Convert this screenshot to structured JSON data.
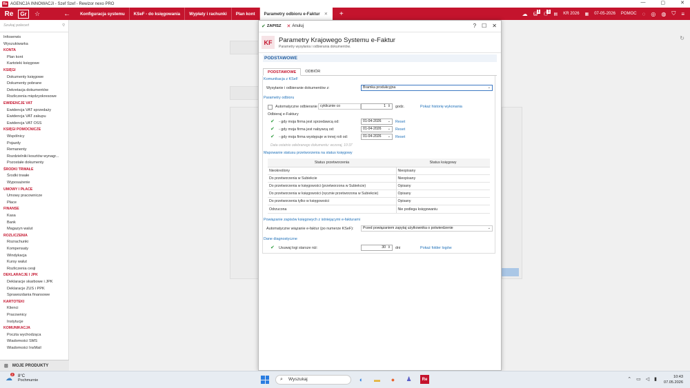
{
  "window": {
    "app_icon": "Re",
    "title": "AGENCJA INNOWACJI - Szef Szef - Rewizor nexo PRO",
    "controls": [
      "—",
      "▢",
      "✕"
    ]
  },
  "toolbar": {
    "logo": "Re",
    "logo2": "Gr",
    "tabs": [
      "Konfiguracja systemu",
      "KSeF - do księgowania",
      "Wypłaty i rachunki",
      "Plan kont",
      "Parametry odbioru e-Faktur"
    ],
    "active_tab_close": "✕",
    "right": {
      "badge1": "1",
      "badge2": "1",
      "year": "KR 2026",
      "date": "07-05-2026",
      "help": "POMOC"
    }
  },
  "sidebar": {
    "search_placeholder": "Szukaj poleceń",
    "items": [
      {
        "t": "Infoserwis",
        "k": "top"
      },
      {
        "t": "Wyszukiwarka",
        "k": "top"
      },
      {
        "t": "KONTA",
        "k": "sec"
      },
      {
        "t": "Plan kont",
        "k": "it"
      },
      {
        "t": "Kartoteki księgowe",
        "k": "it"
      },
      {
        "t": "KSIĘGI",
        "k": "sec"
      },
      {
        "t": "Dokumenty księgowe",
        "k": "it"
      },
      {
        "t": "Dokumenty pobrane",
        "k": "it"
      },
      {
        "t": "Dekretacja dokumentów",
        "k": "it"
      },
      {
        "t": "Rozliczenia międzyokresowe",
        "k": "it"
      },
      {
        "t": "EWIDENCJE VAT",
        "k": "sec"
      },
      {
        "t": "Ewidencja VAT sprzedaży",
        "k": "it"
      },
      {
        "t": "Ewidencja VAT zakupu",
        "k": "it"
      },
      {
        "t": "Ewidencja VAT OSS",
        "k": "it"
      },
      {
        "t": "KSIĘGI POMOCNICZE",
        "k": "sec"
      },
      {
        "t": "Wspólnicy",
        "k": "it"
      },
      {
        "t": "Pojazdy",
        "k": "it"
      },
      {
        "t": "Remanenty",
        "k": "it"
      },
      {
        "t": "Rozdzielniki kosztów wynagr...",
        "k": "it"
      },
      {
        "t": "Pozostałe dokumenty",
        "k": "it"
      },
      {
        "t": "ŚRODKI TRWAŁE",
        "k": "sec"
      },
      {
        "t": "Środki trwałe",
        "k": "it"
      },
      {
        "t": "Wyposażenie",
        "k": "it"
      },
      {
        "t": "UMOWY I PŁACE",
        "k": "sec"
      },
      {
        "t": "Umowy pracownicze",
        "k": "it"
      },
      {
        "t": "Płace",
        "k": "it"
      },
      {
        "t": "FINANSE",
        "k": "sec"
      },
      {
        "t": "Kasa",
        "k": "it"
      },
      {
        "t": "Bank",
        "k": "it"
      },
      {
        "t": "Magazyn walut",
        "k": "it"
      },
      {
        "t": "ROZLICZENIA",
        "k": "sec"
      },
      {
        "t": "Rozrachunki",
        "k": "it"
      },
      {
        "t": "Kompensaty",
        "k": "it"
      },
      {
        "t": "Windykacja",
        "k": "it"
      },
      {
        "t": "Kursy walut",
        "k": "it"
      },
      {
        "t": "Rozliczenia cesji",
        "k": "it"
      },
      {
        "t": "DEKLARACJE I JPK",
        "k": "sec"
      },
      {
        "t": "Deklaracje skarbowe i JPK",
        "k": "it"
      },
      {
        "t": "Deklaracje ZUS i PPK",
        "k": "it"
      },
      {
        "t": "Sprawozdania finansowe",
        "k": "it"
      },
      {
        "t": "KARTOTEKI",
        "k": "sec"
      },
      {
        "t": "Klienci",
        "k": "it"
      },
      {
        "t": "Pracownicy",
        "k": "it"
      },
      {
        "t": "Instytucje",
        "k": "it"
      },
      {
        "t": "KOMUNIKACJA",
        "k": "sec"
      },
      {
        "t": "Poczta wychodząca",
        "k": "it"
      },
      {
        "t": "Wiadomości SMS",
        "k": "it"
      },
      {
        "t": "Wiadomości InsMail",
        "k": "it"
      }
    ],
    "my_products": "MOJE PRODUKTY"
  },
  "dialog": {
    "save": "ZAPISZ",
    "cancel": "Anuluj",
    "help": "?",
    "kf": "KF",
    "title": "Parametry Krajowego Systemu e-Faktur",
    "subtitle": "Parametry wysyłania i odbierania dokumentów.",
    "section": "PODSTAWOWE",
    "tabs": [
      "PODSTAWOWE",
      "ODBIÓR"
    ],
    "komunikacja": {
      "header": "Komunikacja z KSeF",
      "label": "Wysyłanie i odbieranie dokumentów z:",
      "value": "Bramka produkcyjna"
    },
    "parametry": {
      "header": "Parametry odbioru",
      "auto_label": "Automatyczne odbieranie",
      "auto_value": "cyklicznie co",
      "interval": "1",
      "unit": "godz.",
      "history_link": "Pokaż historię wykonania",
      "odbieraj": "Odbieraj e-Faktury",
      "rows": [
        {
          "label": "- gdy moja firma jest sprzedawcą od:",
          "date": "01-04-2026",
          "reset": "Reset"
        },
        {
          "label": "- gdy moja firma jest nabywcą od:",
          "date": "01-04-2026",
          "reset": "Reset"
        },
        {
          "label": "- gdy moja firma występuje w innej roli od:",
          "date": "01-04-2026",
          "reset": "Reset"
        }
      ],
      "last": "Data ostatnio odebranego dokumentu: wczoraj, 10:37"
    },
    "mapping": {
      "header": "Mapowanie statusu przetworzenia na status księgowy",
      "col1": "Status przetworzenia",
      "col2": "Status księgowy",
      "rows": [
        [
          "Nieokreślony",
          "Nieopisany"
        ],
        [
          "Do przetworzenia w Subiekcie",
          "Nieopisany"
        ],
        [
          "Do przetworzenia w księgowości (przetworzona w Subiekcie)",
          "Opisany"
        ],
        [
          "Do przetworzenia w księgowości (ręcznie przetworzona w Subiekcie)",
          "Opisany"
        ],
        [
          "Do przetworzenia tylko w księgowości",
          "Opisany"
        ],
        [
          "Odrzucona",
          "Nie podlega księgowaniu"
        ]
      ]
    },
    "powiazanie": {
      "header": "Powiązanie zapisów księgowych z istniejącymi e-fakturami",
      "label": "Automatyczne wiązanie e-faktur (po numerze KSeF):",
      "value": "Przed powiązaniem zapytaj użytkownika o potwierdzenie"
    },
    "diag": {
      "header": "Dane diagnostyczne",
      "label": "Usuwaj logi starsze niż:",
      "value": "30",
      "unit": "dni",
      "link": "Pokaż folder logów"
    }
  },
  "taskbar": {
    "weather_badge": "2",
    "temp": "8°C",
    "condition": "Pochmurnie",
    "search": "Wyszukaj",
    "time": "10:43",
    "date": "07.05.2026"
  }
}
